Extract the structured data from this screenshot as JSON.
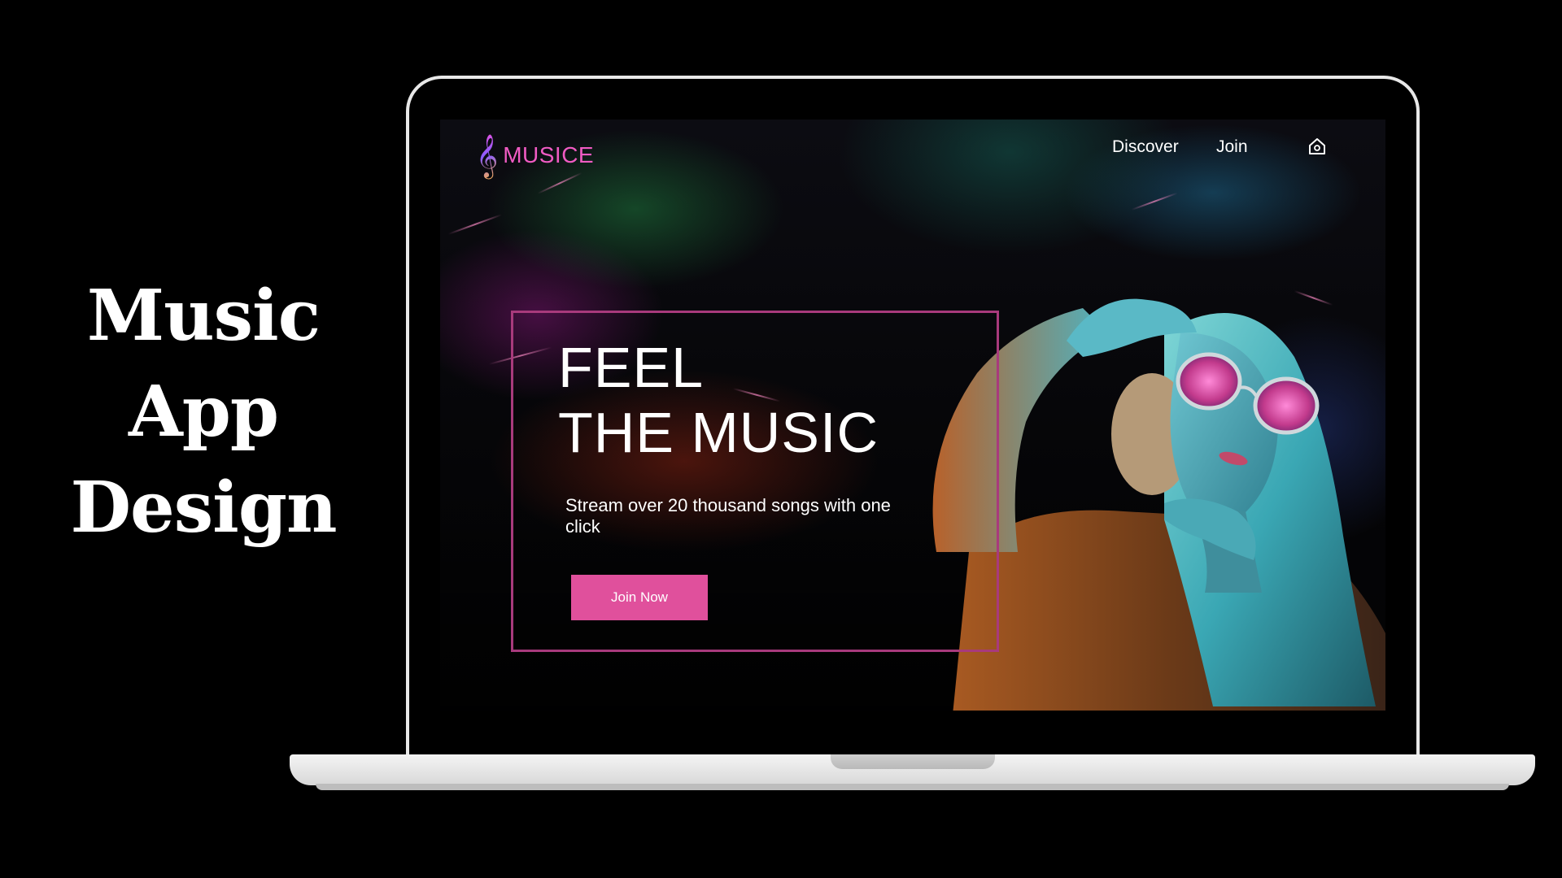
{
  "side_title": [
    "Music",
    "App",
    "Design"
  ],
  "app": {
    "brand": "MUSICE",
    "logo_icon": "treble-clef-icon",
    "nav": {
      "discover": "Discover",
      "join": "Join",
      "home_icon": "home-icon"
    }
  },
  "hero": {
    "headline_line1": "FEEL",
    "headline_line2": "THE MUSIC",
    "subtext": "Stream over 20 thousand songs with one click",
    "cta_label": "Join Now"
  },
  "colors": {
    "accent": "#e0509c",
    "brand": "#f05bc3",
    "frame": "#a83a7c",
    "background": "#000000"
  }
}
